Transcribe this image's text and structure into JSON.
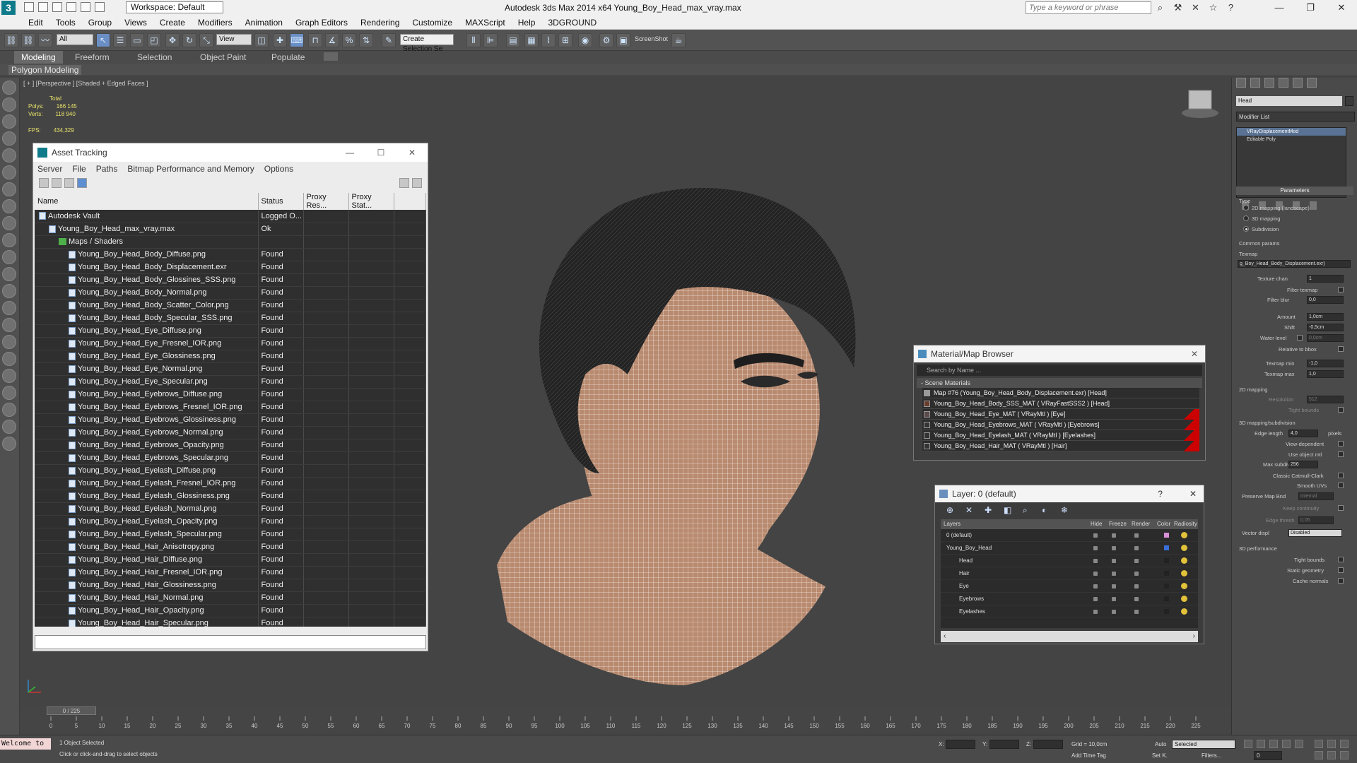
{
  "window": {
    "title": "Autodesk 3ds Max  2014 x64     Young_Boy_Head_max_vray.max",
    "workspace": "Workspace: Default",
    "search_placeholder": "Type a keyword or phrase",
    "minimize": "—",
    "maximize": "❐",
    "close": "✕"
  },
  "menu": [
    "Edit",
    "Tools",
    "Group",
    "Views",
    "Create",
    "Modifiers",
    "Animation",
    "Graph Editors",
    "Rendering",
    "Customize",
    "MAXScript",
    "Help",
    "3DGROUND"
  ],
  "toolbar": {
    "selection_filter": "All",
    "ref_coord": "View",
    "named_selection": "Create Selection Se",
    "screenshot_label": "ScreenShot"
  },
  "ribbon": {
    "tabs": [
      "Modeling",
      "Freeform",
      "Selection",
      "Object Paint",
      "Populate"
    ],
    "active_tab": "Modeling",
    "panel": "Polygon Modeling"
  },
  "viewport": {
    "label": "[ + ] [Perspective ] [Shaded + Edged Faces ]",
    "stats": {
      "total_label": "Total",
      "polys_label": "Polys:",
      "polys": "166 145",
      "verts_label": "Verts:",
      "verts": "118 940",
      "fps_label": "FPS:",
      "fps": "434,329"
    }
  },
  "asset_tracking": {
    "title": "Asset Tracking",
    "menu": [
      "Server",
      "File",
      "Paths",
      "Bitmap Performance and Memory",
      "Options"
    ],
    "columns": [
      "Name",
      "Status",
      "Proxy Res...",
      "Proxy Stat..."
    ],
    "rows": [
      {
        "name": "Autodesk Vault",
        "status": "Logged O...",
        "level": 0,
        "icon": "vault"
      },
      {
        "name": "Young_Boy_Head_max_vray.max",
        "status": "Ok",
        "level": 1,
        "icon": "max"
      },
      {
        "name": "Maps / Shaders",
        "status": "",
        "level": 2,
        "icon": "folder"
      },
      {
        "name": "Young_Boy_Head_Body_Diffuse.png",
        "status": "Found",
        "level": 3,
        "icon": "file"
      },
      {
        "name": "Young_Boy_Head_Body_Displacement.exr",
        "status": "Found",
        "level": 3,
        "icon": "file"
      },
      {
        "name": "Young_Boy_Head_Body_Glossines_SSS.png",
        "status": "Found",
        "level": 3,
        "icon": "file"
      },
      {
        "name": "Young_Boy_Head_Body_Normal.png",
        "status": "Found",
        "level": 3,
        "icon": "file"
      },
      {
        "name": "Young_Boy_Head_Body_Scatter_Color.png",
        "status": "Found",
        "level": 3,
        "icon": "file"
      },
      {
        "name": "Young_Boy_Head_Body_Specular_SSS.png",
        "status": "Found",
        "level": 3,
        "icon": "file"
      },
      {
        "name": "Young_Boy_Head_Eye_Diffuse.png",
        "status": "Found",
        "level": 3,
        "icon": "file"
      },
      {
        "name": "Young_Boy_Head_Eye_Fresnel_IOR.png",
        "status": "Found",
        "level": 3,
        "icon": "file"
      },
      {
        "name": "Young_Boy_Head_Eye_Glossiness.png",
        "status": "Found",
        "level": 3,
        "icon": "file"
      },
      {
        "name": "Young_Boy_Head_Eye_Normal.png",
        "status": "Found",
        "level": 3,
        "icon": "file"
      },
      {
        "name": "Young_Boy_Head_Eye_Specular.png",
        "status": "Found",
        "level": 3,
        "icon": "file"
      },
      {
        "name": "Young_Boy_Head_Eyebrows_Diffuse.png",
        "status": "Found",
        "level": 3,
        "icon": "file"
      },
      {
        "name": "Young_Boy_Head_Eyebrows_Fresnel_IOR.png",
        "status": "Found",
        "level": 3,
        "icon": "file"
      },
      {
        "name": "Young_Boy_Head_Eyebrows_Glossiness.png",
        "status": "Found",
        "level": 3,
        "icon": "file"
      },
      {
        "name": "Young_Boy_Head_Eyebrows_Normal.png",
        "status": "Found",
        "level": 3,
        "icon": "file"
      },
      {
        "name": "Young_Boy_Head_Eyebrows_Opacity.png",
        "status": "Found",
        "level": 3,
        "icon": "file"
      },
      {
        "name": "Young_Boy_Head_Eyebrows_Specular.png",
        "status": "Found",
        "level": 3,
        "icon": "file"
      },
      {
        "name": "Young_Boy_Head_Eyelash_Diffuse.png",
        "status": "Found",
        "level": 3,
        "icon": "file"
      },
      {
        "name": "Young_Boy_Head_Eyelash_Fresnel_IOR.png",
        "status": "Found",
        "level": 3,
        "icon": "file"
      },
      {
        "name": "Young_Boy_Head_Eyelash_Glossiness.png",
        "status": "Found",
        "level": 3,
        "icon": "file"
      },
      {
        "name": "Young_Boy_Head_Eyelash_Normal.png",
        "status": "Found",
        "level": 3,
        "icon": "file"
      },
      {
        "name": "Young_Boy_Head_Eyelash_Opacity.png",
        "status": "Found",
        "level": 3,
        "icon": "file"
      },
      {
        "name": "Young_Boy_Head_Eyelash_Specular.png",
        "status": "Found",
        "level": 3,
        "icon": "file"
      },
      {
        "name": "Young_Boy_Head_Hair_Anisotropy.png",
        "status": "Found",
        "level": 3,
        "icon": "file"
      },
      {
        "name": "Young_Boy_Head_Hair_Diffuse.png",
        "status": "Found",
        "level": 3,
        "icon": "file"
      },
      {
        "name": "Young_Boy_Head_Hair_Fresnel_IOR.png",
        "status": "Found",
        "level": 3,
        "icon": "file"
      },
      {
        "name": "Young_Boy_Head_Hair_Glossiness.png",
        "status": "Found",
        "level": 3,
        "icon": "file"
      },
      {
        "name": "Young_Boy_Head_Hair_Normal.png",
        "status": "Found",
        "level": 3,
        "icon": "file"
      },
      {
        "name": "Young_Boy_Head_Hair_Opacity.png",
        "status": "Found",
        "level": 3,
        "icon": "file"
      },
      {
        "name": "Young_Boy_Head_Hair_Specular.png",
        "status": "Found",
        "level": 3,
        "icon": "file"
      }
    ]
  },
  "material_browser": {
    "title": "Material/Map Browser",
    "search_placeholder": "Search by Name ...",
    "group": "- Scene Materials",
    "items": [
      {
        "label": "Map #76 (Young_Boy_Head_Body_Displacement.exr) [Head]",
        "swatch": "#9a9a9a",
        "flag": false
      },
      {
        "label": "Young_Boy_Head_Body_SSS_MAT ( VRayFastSSS2 ) [Head]",
        "swatch": "#6a3c2c",
        "flag": false
      },
      {
        "label": "Young_Boy_Head_Eye_MAT ( VRayMtl ) [Eye]",
        "swatch": "#5b4a4a",
        "flag": true
      },
      {
        "label": "Young_Boy_Head_Eyebrows_MAT ( VRayMtl ) [Eyebrows]",
        "swatch": "#333333",
        "flag": true
      },
      {
        "label": "Young_Boy_Head_Eyelash_MAT ( VRayMtl ) [Eyelashes]",
        "swatch": "#333333",
        "flag": true
      },
      {
        "label": "Young_Boy_Head_Hair_MAT ( VRayMtl ) [Hair]",
        "swatch": "#333333",
        "flag": true
      }
    ]
  },
  "layer_manager": {
    "title": "Layer: 0 (default)",
    "help": "?",
    "columns": [
      "Layers",
      "Hide",
      "Freeze",
      "Render",
      "Color",
      "Radiosity"
    ],
    "rows": [
      {
        "name": "0 (default)",
        "indent": 0,
        "color": "#d88fd8",
        "current": true
      },
      {
        "name": "Young_Boy_Head",
        "indent": 0,
        "color": "#3a6ed8",
        "current": false
      },
      {
        "name": "Head",
        "indent": 1,
        "color": "#222222",
        "current": false
      },
      {
        "name": "Hair",
        "indent": 1,
        "color": "#222222",
        "current": false
      },
      {
        "name": "Eye",
        "indent": 1,
        "color": "#222222",
        "current": false
      },
      {
        "name": "Eyebrows",
        "indent": 1,
        "color": "#222222",
        "current": false
      },
      {
        "name": "Eyelashes",
        "indent": 1,
        "color": "#222222",
        "current": false
      }
    ]
  },
  "command_panel": {
    "object_name": "Head",
    "modifier_list": "Modifier List",
    "stack": [
      "VRayDisplacementMod",
      "Editable Poly"
    ],
    "parameters_title": "Parameters",
    "type_label": "Type",
    "type_options": [
      "2D mapping (landscape)",
      "3D mapping",
      "Subdivision"
    ],
    "type_selected": 2,
    "common_params": "Common params",
    "texmap_label": "Texmap",
    "texmap_value": "g_Boy_Head_Body_Displacement.exr)",
    "texture_chan_label": "Texture chan",
    "texture_chan": "1",
    "filter_texmap": "Filter texmap",
    "filter_blur_label": "Filter blur",
    "filter_blur": "0,0",
    "amount_label": "Amount",
    "amount": "1,0cm",
    "shift_label": "Shift",
    "shift": "-0,5cm",
    "water_level_label": "Water level",
    "water_level": "0,0cm",
    "relative_bbox": "Relative to bbox",
    "texmap_min_label": "Texmap min",
    "texmap_min": "-1,0",
    "texmap_max_label": "Texmap max",
    "texmap_max": "1,0",
    "mapping_2d": "2D mapping",
    "resolution_label": "Resolution",
    "resolution": "512",
    "tight_bounds": "Tight bounds",
    "mapping_3d": "3D mapping/subdivision",
    "edge_length_label": "Edge length",
    "edge_length": "4,0",
    "pixels": "pixels",
    "view_dependent": "View-dependent",
    "use_object_mtl": "Use object mtl",
    "max_subdivs_label": "Max subdivs",
    "max_subdivs": "256",
    "classic_catmull": "Classic Catmull-Clark",
    "smooth_uvs": "Smooth UVs",
    "preserve_map_bnd_label": "Preserve Map Bnd",
    "preserve_map_bnd": "Internal",
    "keep_continuity": "Keep continuity",
    "edge_thresh_label": "Edge thresh",
    "edge_thresh": "0,05",
    "vector_displ_label": "Vector displ",
    "vector_displ": "Disabled",
    "performance": "3D performance",
    "tight_bounds2": "Tight bounds",
    "static_geometry": "Static geometry",
    "cache_normals": "Cache normals"
  },
  "timeline": {
    "frame": "0 / 225",
    "ticks": [
      "0",
      "5",
      "10",
      "15",
      "20",
      "25",
      "30",
      "35",
      "40",
      "45",
      "50",
      "55",
      "60",
      "65",
      "70",
      "75",
      "80",
      "85",
      "90",
      "95",
      "100",
      "105",
      "110",
      "115",
      "120",
      "125",
      "130",
      "135",
      "140",
      "145",
      "150",
      "155",
      "160",
      "165",
      "170",
      "175",
      "180",
      "185",
      "190",
      "195",
      "200",
      "205",
      "210",
      "215",
      "220",
      "225"
    ]
  },
  "status": {
    "welcome": "Welcome to",
    "selection": "1 Object Selected",
    "prompt": "Click or click-and-drag to select objects",
    "x_label": "X:",
    "y_label": "Y:",
    "z_label": "Z:",
    "grid": "Grid = 10,0cm",
    "add_time_tag": "Add Time Tag",
    "auto": "Auto",
    "set_k": "Set K.",
    "selected": "Selected",
    "filters": "Filters...",
    "frame_field": "0"
  }
}
